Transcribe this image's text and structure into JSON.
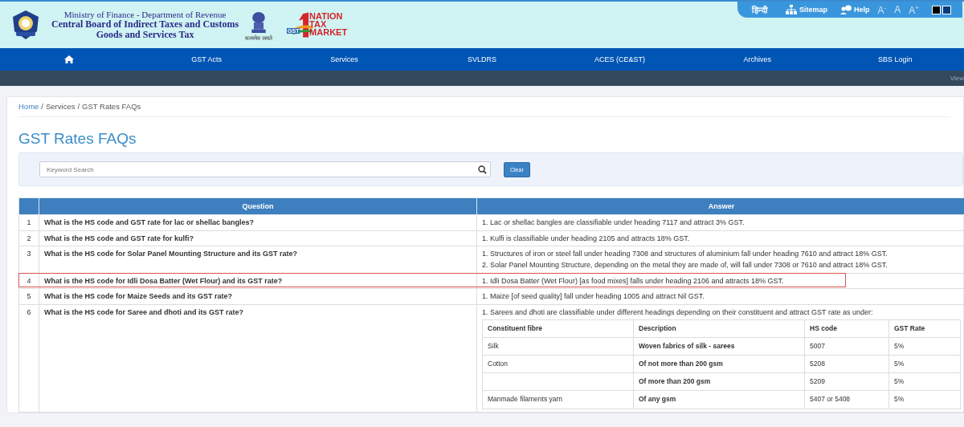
{
  "header": {
    "lines": [
      "Ministry of Finance - Department of Revenue",
      "Central Board of Indirect Taxes and Customs",
      "Goods and Services Tax"
    ],
    "emblem_caption": "सत्यमेव जयते",
    "logo": {
      "badge": "GST",
      "words": [
        "NATION",
        "TAX",
        "MARKET"
      ]
    }
  },
  "utility_bar": [
    {
      "kind": "link",
      "label": "हिन्दी"
    },
    {
      "kind": "sitemap",
      "label": "Sitemap"
    },
    {
      "kind": "help",
      "label": "Help"
    },
    {
      "kind": "font",
      "label": "A",
      "sup": "-"
    },
    {
      "kind": "font",
      "label": "A"
    },
    {
      "kind": "font",
      "label": "A",
      "sup": "+"
    },
    {
      "kind": "contrast"
    }
  ],
  "nav": [
    "GST Acts",
    "Services",
    "SVLDRS",
    "ACES (CE&ST)",
    "Archives",
    "SBS Login"
  ],
  "subbar": {
    "text": "View"
  },
  "breadcrumb_separator": "/",
  "breadcrumb": [
    {
      "label": "Home",
      "link": true
    },
    {
      "label": "Services",
      "link": false
    },
    {
      "label": "GST Rates FAQs",
      "link": false
    }
  ],
  "title": "GST Rates FAQs",
  "search": {
    "placeholder": "Keyword Search",
    "button": "Clear"
  },
  "table": {
    "columns": [
      "Question",
      "Answer"
    ],
    "rows": [
      {
        "number": "1",
        "question": "What is the HS code and GST rate for lac or shellac bangles?",
        "answer": [
          "1. Lac or shellac bangles are classifiable under heading 7117 and attract 3% GST."
        ],
        "highlighted": false
      },
      {
        "number": "2",
        "question": "What is the HS code and GST rate for kulfi?",
        "answer": [
          "1. Kulfi is classifiable under heading 2105 and attracts 18% GST."
        ],
        "highlighted": false
      },
      {
        "number": "3",
        "question": "What is the HS code for Solar Panel Mounting Structure and its GST rate?",
        "answer": [
          "1. Structures of iron or steel fall under heading 7308 and structures of aluminium fall under heading 7610 and attract 18% GST.",
          "2. Solar Panel Mounting Structure, depending on the metal they are made of, will fall under 7308 or 7610 and attract 18% GST."
        ],
        "highlighted": false
      },
      {
        "number": "4",
        "question": "What is the HS code for Idli Dosa Batter (Wet Flour) and its GST rate?",
        "answer": [
          "1. Idli Dosa Batter (Wet Flour) [as food mixes] falls under heading 2106 and attracts 18% GST."
        ],
        "highlighted": true
      },
      {
        "number": "5",
        "question": "What is the HS code for Maize Seeds and its GST rate?",
        "answer": [
          "1. Maize [of seed quality] fall under heading 1005 and attract Nil GST."
        ],
        "highlighted": false
      },
      {
        "number": "6",
        "question": "What is the HS code for Saree and dhoti and its GST rate?",
        "answer": [
          "1. Sarees and dhoti are classifiable under different headings depending on their constituent and attract GST rate as under:"
        ],
        "highlighted": false,
        "subtable": {
          "columns": [
            "Constituent fibre",
            "Description",
            "HS code",
            "GST Rate"
          ],
          "rows": [
            [
              "Silk",
              "Woven fabrics of silk - sarees",
              "5007",
              "5%"
            ],
            [
              "Cotton",
              "Of not more than 200 gsm",
              "5208",
              "5%"
            ],
            [
              "",
              "Of more than 200 gsm",
              "5209",
              "5%"
            ],
            [
              "Manmade filaments yarn",
              "Of any gsm",
              "5407 or 5408",
              "5%"
            ]
          ]
        }
      }
    ]
  }
}
